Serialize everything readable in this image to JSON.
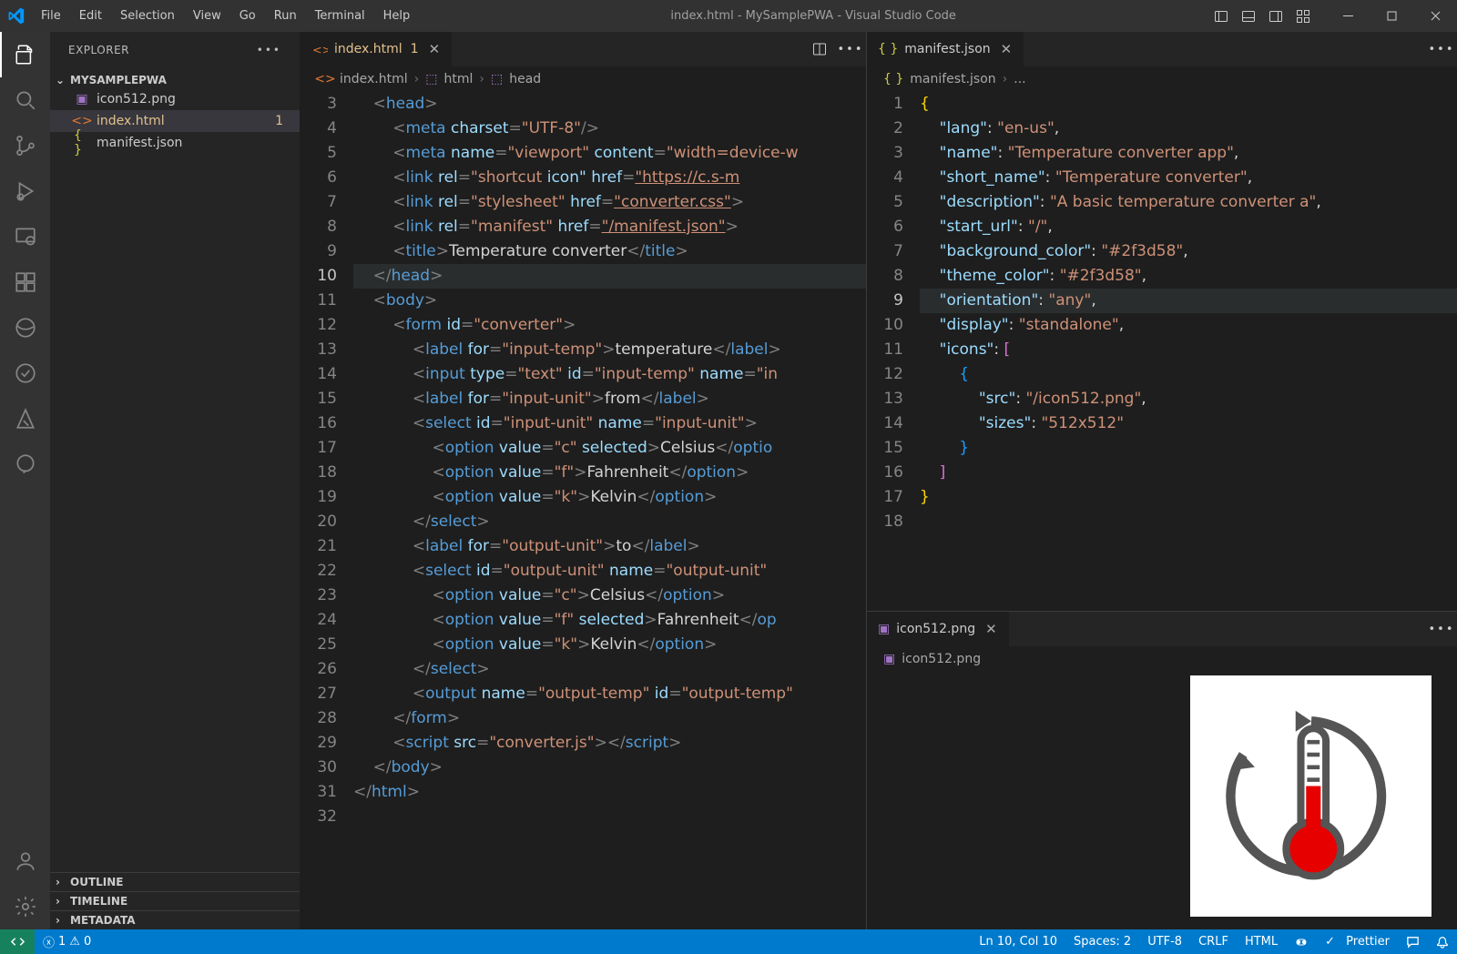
{
  "window": {
    "title": "index.html - MySamplePWA - Visual Studio Code"
  },
  "menu": [
    "File",
    "Edit",
    "Selection",
    "View",
    "Go",
    "Run",
    "Terminal",
    "Help"
  ],
  "explorer": {
    "title": "EXPLORER",
    "folder": "MYSAMPLEPWA",
    "files": [
      {
        "name": "icon512.png",
        "icon": "image"
      },
      {
        "name": "index.html",
        "icon": "code",
        "modified": true,
        "selected": true,
        "badge": "1"
      },
      {
        "name": "manifest.json",
        "icon": "json"
      }
    ],
    "sections": [
      "OUTLINE",
      "TIMELINE",
      "METADATA"
    ]
  },
  "leftEditor": {
    "tab": {
      "name": "index.html",
      "modified": "1"
    },
    "breadcrumb": [
      "index.html",
      "html",
      "head"
    ],
    "startLine": 3,
    "currentLine": 10,
    "lines": [
      "    <head>",
      "        <meta charset=\"UTF-8\" />",
      "        <meta name=\"viewport\" content=\"width=device-w",
      "        <link rel=\"shortcut icon\" href=\"https://c.s-m",
      "        <link rel=\"stylesheet\" href=\"converter.css\">",
      "        <link rel=\"manifest\" href=\"/manifest.json\">",
      "        <title>Temperature converter</title>",
      "    </head>",
      "    <body>",
      "        <form id=\"converter\">",
      "            <label for=\"input-temp\">temperature</label>",
      "            <input type=\"text\" id=\"input-temp\" name=\"in",
      "            <label for=\"input-unit\">from</label>",
      "            <select id=\"input-unit\" name=\"input-unit\">",
      "                <option value=\"c\" selected>Celsius</optio",
      "                <option value=\"f\">Fahrenheit</option>",
      "                <option value=\"k\">Kelvin</option>",
      "            </select>",
      "            <label for=\"output-unit\">to</label>",
      "            <select id=\"output-unit\" name=\"output-unit\"",
      "                <option value=\"c\">Celsius</option>",
      "                <option value=\"f\" selected>Fahrenheit</op",
      "                <option value=\"k\">Kelvin</option>",
      "            </select>",
      "            <output name=\"output-temp\" id=\"output-temp\"",
      "        </form>",
      "        <script src=\"converter.js\"></script>",
      "    </body>",
      "</html>",
      ""
    ]
  },
  "rightTop": {
    "tab": {
      "name": "manifest.json"
    },
    "breadcrumb": [
      "manifest.json",
      "..."
    ],
    "startLine": 1,
    "currentLine": 9,
    "json": {
      "lang": "en-us",
      "name": "Temperature converter app",
      "short_name": "Temperature converter",
      "description": "A basic temperature converter a",
      "start_url": "/",
      "background_color": "#2f3d58",
      "theme_color": "#2f3d58",
      "orientation": "any",
      "display": "standalone",
      "icons": [
        {
          "src": "/icon512.png",
          "sizes": "512x512"
        }
      ]
    }
  },
  "rightBottom": {
    "tab": {
      "name": "icon512.png"
    },
    "breadcrumb": "icon512.png"
  },
  "status": {
    "errors": "1",
    "warnings": "0",
    "cursor": "Ln 10, Col 10",
    "spaces": "Spaces: 2",
    "encoding": "UTF-8",
    "eol": "CRLF",
    "lang": "HTML",
    "prettier": "Prettier"
  }
}
